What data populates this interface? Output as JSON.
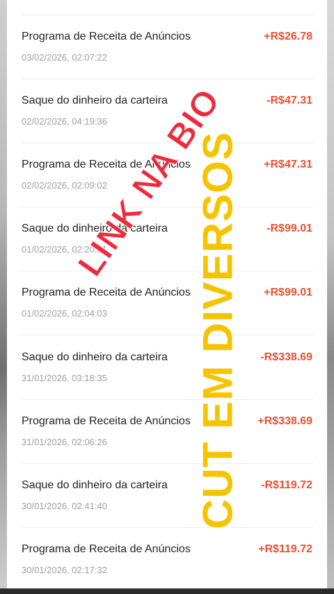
{
  "colors": {
    "positive": "#ee4d2d",
    "negative": "#ee4d2d",
    "overlay_red": "#ee2a3d",
    "overlay_yellow": "#f5c400"
  },
  "transactions": [
    {
      "title": "Programa de Receita de Anúncios",
      "date": "03/02/2026, 02:07:22",
      "amount": "+R$26.78"
    },
    {
      "title": "Saque do dinheiro da carteira",
      "date": "02/02/2026, 04:19:36",
      "amount": "-R$47.31"
    },
    {
      "title": "Programa de Receita de Anúncios",
      "date": "02/02/2026, 02:09:02",
      "amount": "+R$47.31"
    },
    {
      "title": "Saque do dinheiro da carteira",
      "date": "01/02/2026, 02:20:51",
      "amount": "-R$99.01"
    },
    {
      "title": "Programa de Receita de Anúncios",
      "date": "01/02/2026, 02:04:03",
      "amount": "+R$99.01"
    },
    {
      "title": "Saque do dinheiro da carteira",
      "date": "31/01/2026, 03:18:35",
      "amount": "-R$338.69"
    },
    {
      "title": "Programa de Receita de Anúncios",
      "date": "31/01/2026, 02:06:26",
      "amount": "+R$338.69"
    },
    {
      "title": "Saque do dinheiro da carteira",
      "date": "30/01/2026, 02:41:40",
      "amount": "-R$119.72"
    },
    {
      "title": "Programa de Receita de Anúncios",
      "date": "30/01/2026, 02:17:32",
      "amount": "+R$119.72"
    }
  ],
  "overlays": {
    "red_text": "LINK NA BIO",
    "yellow_text": "CUT EM DIVERSOS"
  }
}
